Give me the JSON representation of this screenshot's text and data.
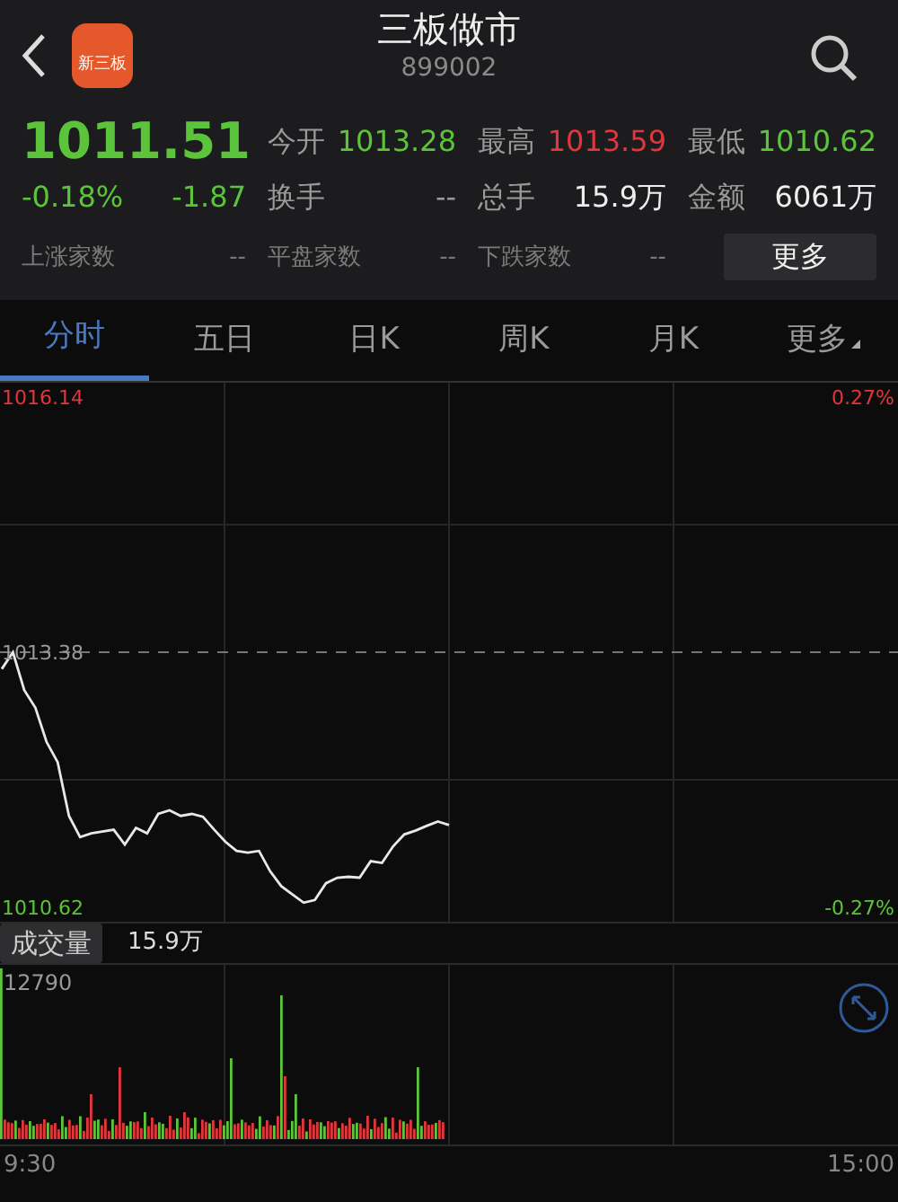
{
  "header": {
    "app_badge": "新三板",
    "title": "三板做市",
    "code": "899002"
  },
  "quote": {
    "price": "1011.51",
    "change_pct": "-0.18%",
    "change": "-1.87",
    "color": "#5cc43a"
  },
  "stats": [
    [
      {
        "label": "今开",
        "value": "1013.28",
        "color": "#5cc43a"
      },
      {
        "label": "最高",
        "value": "1013.59",
        "color": "#e0363c"
      },
      {
        "label": "最低",
        "value": "1010.62",
        "color": "#5cc43a"
      }
    ],
    [
      {
        "label": "换手",
        "value": "--",
        "color": "#9a9a9a"
      },
      {
        "label": "总手",
        "value": "15.9万",
        "color": "#eeeeee"
      },
      {
        "label": "金额",
        "value": "6061万",
        "color": "#eeeeee"
      }
    ]
  ],
  "breadth": [
    {
      "label": "上涨家数",
      "value": "--"
    },
    {
      "label": "平盘家数",
      "value": "--"
    },
    {
      "label": "下跌家数",
      "value": "--"
    }
  ],
  "more_button": "更多",
  "tabs": [
    {
      "label": "分时",
      "selected": true,
      "dropdown": false
    },
    {
      "label": "五日",
      "selected": false,
      "dropdown": false
    },
    {
      "label": "日K",
      "selected": false,
      "dropdown": false
    },
    {
      "label": "周K",
      "selected": false,
      "dropdown": false
    },
    {
      "label": "月K",
      "selected": false,
      "dropdown": false
    },
    {
      "label": "更多",
      "selected": false,
      "dropdown": true
    }
  ],
  "price_chart": {
    "right_labels": [
      "0.27%",
      "-0.27%"
    ],
    "chart_data": {
      "type": "line",
      "ref_lines": [
        {
          "axis": "y",
          "value": 1013.38
        }
      ],
      "ylim": [
        1010.62,
        1016.14
      ],
      "yticks": [
        {
          "value": 1016.14,
          "label": "1016.14"
        },
        {
          "value": 1013.38,
          "label": "1013.38"
        },
        {
          "value": 1010.62,
          "label": "1010.62"
        }
      ],
      "categories": [
        null,
        null,
        null,
        null,
        null,
        null,
        null,
        null,
        null,
        null,
        null,
        null,
        null,
        null,
        null,
        null,
        null,
        null,
        null,
        null,
        null,
        null,
        null,
        null,
        null,
        null,
        null,
        null,
        null,
        null,
        null,
        null,
        null,
        null,
        null,
        null,
        null,
        null,
        null,
        null,
        null,
        null,
        null,
        null,
        null,
        null,
        null,
        null,
        null,
        null,
        null,
        null,
        null,
        null,
        null,
        null,
        null,
        null,
        null,
        null,
        null,
        null,
        null,
        null,
        null,
        null,
        null,
        null,
        null,
        null,
        null,
        null,
        null,
        null,
        null,
        null,
        null,
        null,
        null,
        null,
        null
      ],
      "series": [
        {
          "color": "#e8e8e8",
          "values": [
            1013.2,
            1013.38,
            1012.97,
            1012.78,
            1012.41,
            1012.19,
            1011.61,
            1011.38,
            1011.42,
            1011.44,
            1011.46,
            1011.3,
            1011.48,
            1011.42,
            1011.63,
            1011.67,
            1011.61,
            1011.63,
            1011.6,
            1011.46,
            1011.33,
            1011.23,
            1011.21,
            1011.23,
            1011.01,
            1010.85,
            1010.76,
            1010.67,
            1010.7,
            1010.88,
            1010.94,
            1010.95,
            1010.94,
            1011.12,
            1011.1,
            1011.28,
            1011.41,
            1011.45,
            1011.5,
            1011.55,
            1011.51,
            null,
            null,
            null,
            null,
            null,
            null,
            null,
            null,
            null,
            null,
            null,
            null,
            null,
            null,
            null,
            null,
            null,
            null,
            null,
            null,
            null,
            null,
            null,
            null,
            null,
            null,
            null,
            null,
            null,
            null,
            null,
            null,
            null,
            null,
            null,
            null,
            null,
            null,
            null,
            null
          ]
        }
      ]
    }
  },
  "volume": {
    "label": "成交量",
    "total": "15.9万",
    "max_label": "12790",
    "time_labels": [
      "9:30",
      "15:00"
    ]
  }
}
